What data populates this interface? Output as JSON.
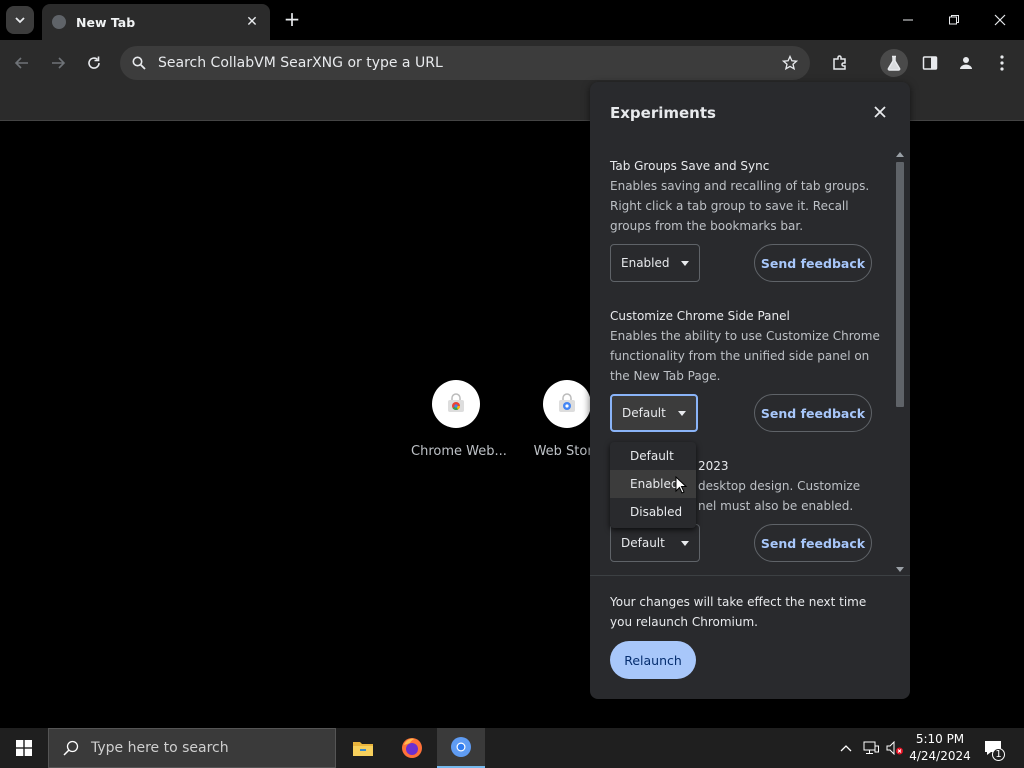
{
  "tab": {
    "title": "New Tab"
  },
  "omnibox": {
    "placeholder": "Search CollabVM SearXNG or type a URL"
  },
  "shortcuts": [
    {
      "label": "Chrome Web..."
    },
    {
      "label": "Web Store"
    }
  ],
  "panel": {
    "title": "Experiments",
    "features": [
      {
        "name": "Tab Groups Save and Sync",
        "desc": "Enables saving and recalling of tab groups. Right click a tab group to save it. Recall groups from the bookmarks bar.",
        "value": "Enabled",
        "feedback": "Send feedback"
      },
      {
        "name": "Customize Chrome Side Panel",
        "desc": "Enables the ability to use Customize Chrome functionality from the unified side panel on the New Tab Page.",
        "value": "Default",
        "feedback": "Send feedback"
      },
      {
        "name": "2023",
        "desc_line1": "desktop design. Customize",
        "desc_line2": "nel must also be enabled.",
        "value": "Default",
        "feedback": "Send feedback"
      }
    ],
    "dropdown_options": [
      "Default",
      "Enabled",
      "Disabled"
    ],
    "note": "Your changes will take effect the next time you relaunch Chromium.",
    "relaunch": "Relaunch"
  },
  "taskbar": {
    "search_placeholder": "Type here to search",
    "time": "5:10 PM",
    "date": "4/24/2024",
    "notification_count": "1"
  }
}
